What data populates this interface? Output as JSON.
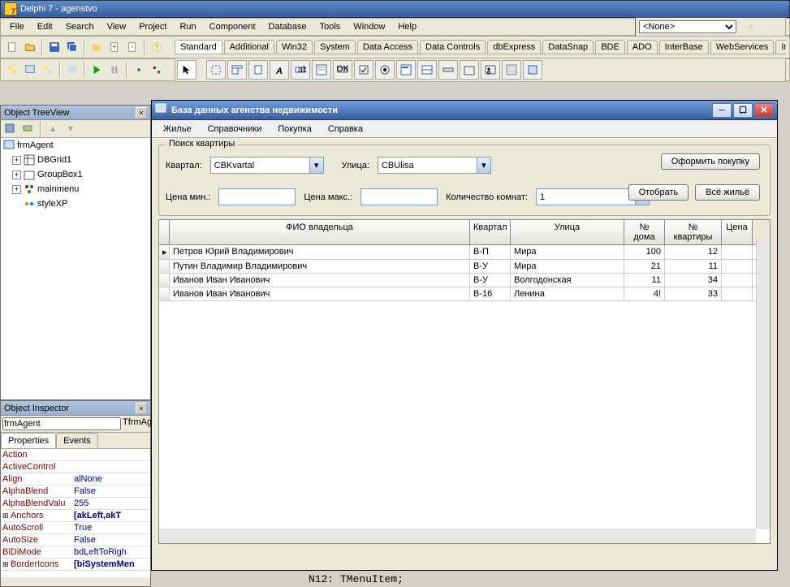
{
  "ide": {
    "title": "Delphi 7 - agenstvo",
    "main_menu": [
      "File",
      "Edit",
      "Search",
      "View",
      "Project",
      "Run",
      "Component",
      "Database",
      "Tools",
      "Window",
      "Help"
    ],
    "combo_value": "<None>",
    "palette_tabs": [
      "Standard",
      "Additional",
      "Win32",
      "System",
      "Data Access",
      "Data Controls",
      "dbExpress",
      "DataSnap",
      "BDE",
      "ADO",
      "InterBase",
      "WebServices",
      "Int"
    ]
  },
  "treeview": {
    "title": "Object TreeView",
    "root": "frmAgent",
    "nodes": [
      "DBGrid1",
      "GroupBox1",
      "mainmenu",
      "styleXP"
    ]
  },
  "inspector": {
    "title": "Object Inspector",
    "object_name": "frmAgent",
    "object_type": "TfrmAgent",
    "tabs": [
      "Properties",
      "Events"
    ],
    "props": [
      {
        "name": "Action",
        "val": ""
      },
      {
        "name": "ActiveControl",
        "val": ""
      },
      {
        "name": "Align",
        "val": "alNone"
      },
      {
        "name": "AlphaBlend",
        "val": "False"
      },
      {
        "name": "AlphaBlendValu",
        "val": "255"
      },
      {
        "name": "Anchors",
        "val": "[akLeft,akT",
        "plus": true
      },
      {
        "name": "AutoScroll",
        "val": "True"
      },
      {
        "name": "AutoSize",
        "val": "False"
      },
      {
        "name": "BiDiMode",
        "val": "bdLeftToRigh"
      },
      {
        "name": "BorderIcons",
        "val": "[biSystemMen",
        "plus": true
      }
    ]
  },
  "form": {
    "title": "База данных агенства недвижимости",
    "menu": [
      "Жилье",
      "Справочники",
      "Покупка",
      "Справка"
    ],
    "groupbox": "Поиск квартиры",
    "labels": {
      "kvartal": "Квартал:",
      "ulica": "Улица:",
      "price_min": "Цена мин.:",
      "price_max": "Цена макс.:",
      "rooms": "Количество комнат:"
    },
    "combos": {
      "kvartal": "CBKvartal",
      "ulica": "CBUlisa",
      "rooms": "1"
    },
    "buttons": {
      "buy": "Оформить покупку",
      "select": "Отобрать",
      "all": "Всё жильё"
    },
    "grid": {
      "headers": [
        "ФИО владельца",
        "Квартал",
        "Улица",
        "№ дома",
        "№ квартиры",
        "Цена"
      ],
      "rows": [
        {
          "fio": "Петров Юрий Владимирович",
          "kv": "В-П",
          "ul": "Мира",
          "nd": "100",
          "nkv": "12",
          "price": "",
          "cur": true
        },
        {
          "fio": "Путин Владимир Владимирович",
          "kv": "В-У",
          "ul": "Мира",
          "nd": "21",
          "nkv": "11",
          "price": ""
        },
        {
          "fio": "Иванов Иван Иванович",
          "kv": "В-У",
          "ul": "Волгодонская",
          "nd": "11",
          "nkv": "34",
          "price": ""
        },
        {
          "fio": "Иванов Иван Иванович",
          "kv": "В-16",
          "ul": "Ленина",
          "nd": "4!",
          "nkv": "33",
          "price": ""
        }
      ]
    }
  },
  "code_hint": "N12: TMenuItem;"
}
